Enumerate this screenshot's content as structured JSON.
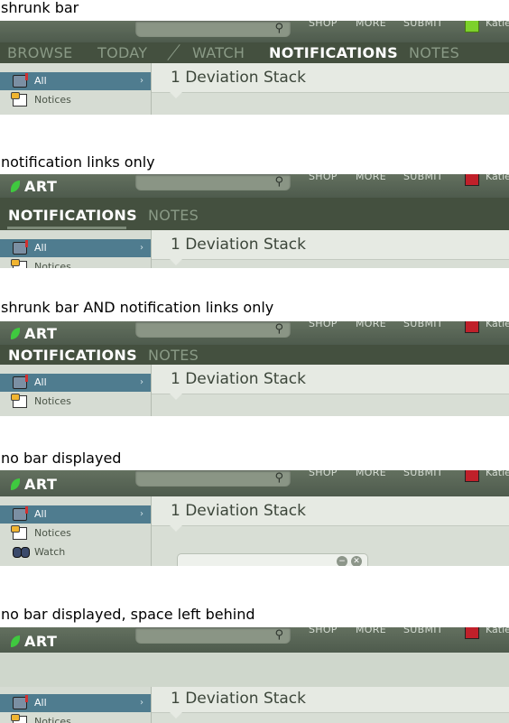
{
  "captions": {
    "s1": "shrunk bar",
    "s2": "notification links only",
    "s3": "shrunk bar AND notification links only",
    "s4": "no bar displayed",
    "s5": "no bar displayed, space left behind"
  },
  "header": {
    "logo": "ART",
    "links": {
      "shop": "SHOP",
      "more": "MORE",
      "submit": "SUBMIT"
    },
    "username": "Katie"
  },
  "nav": {
    "browse": "BROWSE",
    "today": "TODAY",
    "watch": "WATCH",
    "notifications": "NOTIFICATIONS",
    "notes": "NOTES"
  },
  "sidebar": {
    "all": "All",
    "notices": "Notices",
    "watch": "Watch"
  },
  "main": {
    "title": "1 Deviation Stack"
  },
  "icons": [
    "search-icon",
    "leaf-logo-icon",
    "mailbox-icon",
    "notice-icon",
    "binoculars-icon",
    "chevron-right-icon",
    "close-icon"
  ],
  "colors": {
    "accent": "#4f7c8f",
    "navbar": "#44503f",
    "logo_green": "#3fc93f"
  }
}
